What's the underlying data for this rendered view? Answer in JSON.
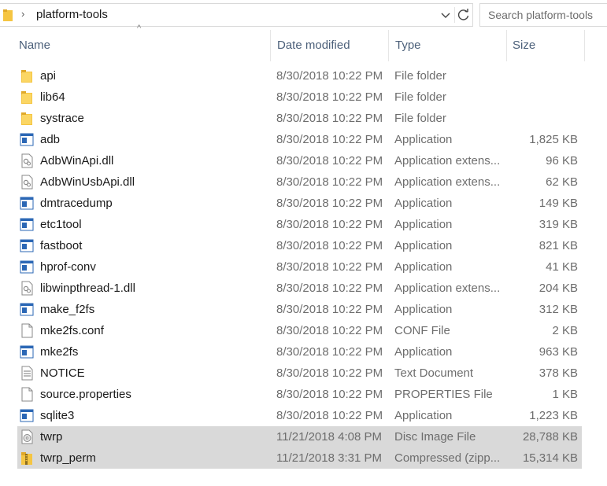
{
  "address": {
    "path": "platform-tools",
    "chevron": "›",
    "search_placeholder": "Search platform-tools"
  },
  "columns": {
    "name": "Name",
    "date": "Date modified",
    "type": "Type",
    "size": "Size",
    "sort_indicator": "^"
  },
  "colors": {
    "selection": "#d9d9d9",
    "folder": "#f5c542",
    "app_icon_blue": "#2b67b5",
    "header_text": "#4c607a"
  },
  "files": [
    {
      "name": "api",
      "date": "8/30/2018 10:22 PM",
      "type": "File folder",
      "size": "",
      "icon": "folder-icon",
      "selected": false
    },
    {
      "name": "lib64",
      "date": "8/30/2018 10:22 PM",
      "type": "File folder",
      "size": "",
      "icon": "folder-icon",
      "selected": false
    },
    {
      "name": "systrace",
      "date": "8/30/2018 10:22 PM",
      "type": "File folder",
      "size": "",
      "icon": "folder-icon",
      "selected": false
    },
    {
      "name": "adb",
      "date": "8/30/2018 10:22 PM",
      "type": "Application",
      "size": "1,825 KB",
      "icon": "application-icon",
      "selected": false
    },
    {
      "name": "AdbWinApi.dll",
      "date": "8/30/2018 10:22 PM",
      "type": "Application extens...",
      "size": "96 KB",
      "icon": "dll-icon",
      "selected": false
    },
    {
      "name": "AdbWinUsbApi.dll",
      "date": "8/30/2018 10:22 PM",
      "type": "Application extens...",
      "size": "62 KB",
      "icon": "dll-icon",
      "selected": false
    },
    {
      "name": "dmtracedump",
      "date": "8/30/2018 10:22 PM",
      "type": "Application",
      "size": "149 KB",
      "icon": "application-icon",
      "selected": false
    },
    {
      "name": "etc1tool",
      "date": "8/30/2018 10:22 PM",
      "type": "Application",
      "size": "319 KB",
      "icon": "application-icon",
      "selected": false
    },
    {
      "name": "fastboot",
      "date": "8/30/2018 10:22 PM",
      "type": "Application",
      "size": "821 KB",
      "icon": "application-icon",
      "selected": false
    },
    {
      "name": "hprof-conv",
      "date": "8/30/2018 10:22 PM",
      "type": "Application",
      "size": "41 KB",
      "icon": "application-icon",
      "selected": false
    },
    {
      "name": "libwinpthread-1.dll",
      "date": "8/30/2018 10:22 PM",
      "type": "Application extens...",
      "size": "204 KB",
      "icon": "dll-icon",
      "selected": false
    },
    {
      "name": "make_f2fs",
      "date": "8/30/2018 10:22 PM",
      "type": "Application",
      "size": "312 KB",
      "icon": "application-icon",
      "selected": false
    },
    {
      "name": "mke2fs.conf",
      "date": "8/30/2018 10:22 PM",
      "type": "CONF File",
      "size": "2 KB",
      "icon": "blank-file-icon",
      "selected": false
    },
    {
      "name": "mke2fs",
      "date": "8/30/2018 10:22 PM",
      "type": "Application",
      "size": "963 KB",
      "icon": "application-icon",
      "selected": false
    },
    {
      "name": "NOTICE",
      "date": "8/30/2018 10:22 PM",
      "type": "Text Document",
      "size": "378 KB",
      "icon": "text-document-icon",
      "selected": false
    },
    {
      "name": "source.properties",
      "date": "8/30/2018 10:22 PM",
      "type": "PROPERTIES File",
      "size": "1 KB",
      "icon": "blank-file-icon",
      "selected": false
    },
    {
      "name": "sqlite3",
      "date": "8/30/2018 10:22 PM",
      "type": "Application",
      "size": "1,223 KB",
      "icon": "application-icon",
      "selected": false
    },
    {
      "name": "twrp",
      "date": "11/21/2018 4:08 PM",
      "type": "Disc Image File",
      "size": "28,788 KB",
      "icon": "disc-image-icon",
      "selected": true
    },
    {
      "name": "twrp_perm",
      "date": "11/21/2018 3:31 PM",
      "type": "Compressed (zipp...",
      "size": "15,314 KB",
      "icon": "zip-folder-icon",
      "selected": true
    }
  ]
}
